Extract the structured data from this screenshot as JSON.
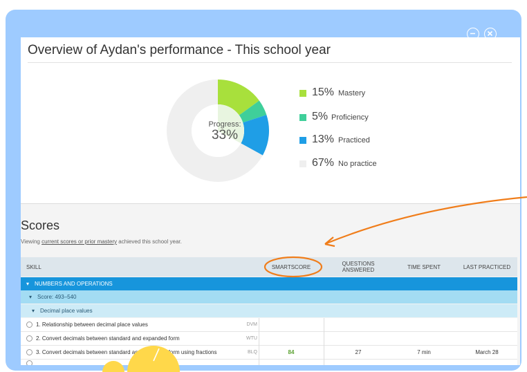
{
  "overview": {
    "title": "Overview of Aydan's performance - This school year"
  },
  "progress": {
    "label": "Progress:",
    "value": "33%"
  },
  "donut": {
    "segments": [
      {
        "name": "Mastery",
        "percent": 15,
        "color": "#a8e03c"
      },
      {
        "name": "Proficiency",
        "percent": 5,
        "color": "#3fcf9a"
      },
      {
        "name": "Practiced",
        "percent": 13,
        "color": "#1f9ee6"
      },
      {
        "name": "No practice",
        "percent": 67,
        "color": "#efefef"
      }
    ],
    "inner_fill": "#e8f5e0"
  },
  "legend": [
    {
      "pct": "15%",
      "label": "Mastery",
      "color": "#a8e03c"
    },
    {
      "pct": "5%",
      "label": "Proficiency",
      "color": "#3fcf9a"
    },
    {
      "pct": "13%",
      "label": "Practiced",
      "color": "#1f9ee6"
    },
    {
      "pct": "67%",
      "label": "No practice",
      "color": "#efefef"
    }
  ],
  "scores": {
    "title": "Scores",
    "sub_prefix": "Viewing ",
    "sub_link": "current scores or prior mastery",
    "sub_suffix": " achieved this school year."
  },
  "table": {
    "headers": {
      "skill": "SKILL",
      "smartscore": "SMARTSCORE",
      "questions_1": "QUESTIONS",
      "questions_2": "ANSWERED",
      "time": "TIME SPENT",
      "last": "LAST PRACTICED"
    },
    "category": "NUMBERS AND OPERATIONS",
    "score_range": "Score: 493–540",
    "subcategory": "Decimal place values",
    "skills": [
      {
        "name": "1. Relationship between decimal place values",
        "code": "DVM",
        "smartscore": "",
        "questions": "",
        "time": "",
        "last": ""
      },
      {
        "name": "2. Convert decimals between standard and expanded form",
        "code": "WTU",
        "smartscore": "",
        "questions": "",
        "time": "",
        "last": ""
      },
      {
        "name": "3. Convert decimals between standard and expanded form using fractions",
        "code": "BLQ",
        "smartscore": "84",
        "questions": "27",
        "time": "7 min",
        "last": "March 28"
      }
    ]
  },
  "colors": {
    "accent": "#f07d1a",
    "modal_bg": "#9ecbff",
    "category_bar": "#1795dc",
    "smartscore_green": "#58a02e"
  }
}
